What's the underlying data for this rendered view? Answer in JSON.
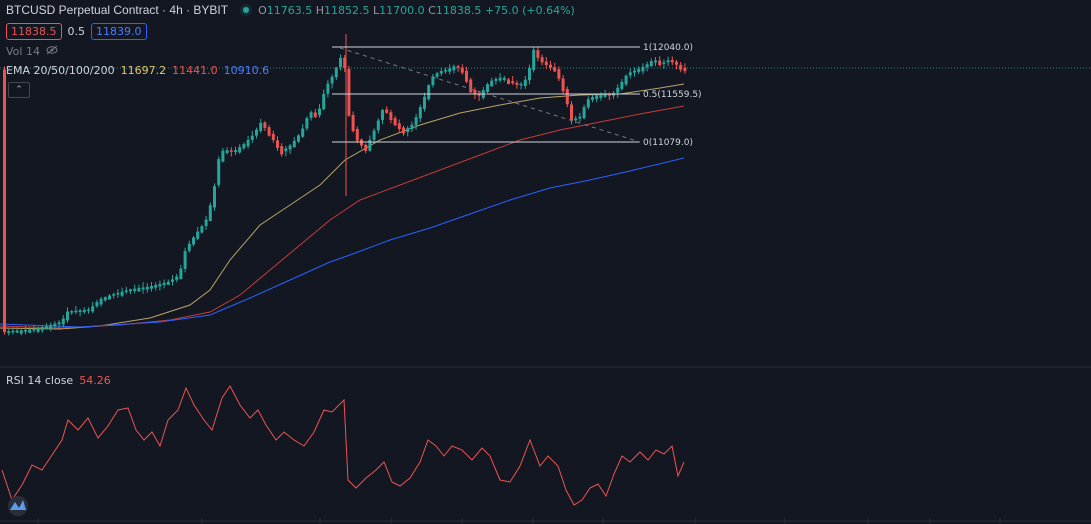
{
  "header": {
    "symbol_title": "BTCUSD Perpetual Contract · 4h · BYBIT",
    "open_label": "O",
    "open": "11763.5",
    "high_label": "H",
    "high": "11852.5",
    "low_label": "L",
    "low": "11700.0",
    "close_label": "C",
    "close": "11838.5",
    "change": "+75.0 (+0.64%)",
    "sell_price": "11838.5",
    "spread": "0.5",
    "buy_price": "11839.0"
  },
  "volume": {
    "label": "Vol 14"
  },
  "ema": {
    "label": "EMA 20/50/100/200",
    "values": [
      "11697.2",
      "11441.0",
      "10910.6"
    ],
    "colors": [
      "#e2c96a",
      "#ef5350",
      "#4f7cff"
    ]
  },
  "fib": {
    "levels": [
      {
        "label": "1(12040.0)"
      },
      {
        "label": "0.5(11559.5)"
      },
      {
        "label": "0(11079.0)"
      }
    ]
  },
  "rsi": {
    "label": "RSI 14 close",
    "value": "54.26",
    "color": "#ef5350"
  },
  "colors": {
    "background": "#131722",
    "up": "#26a69a",
    "down": "#ef5350",
    "current_price_line": "#26a69a",
    "ema20": "#b9a466",
    "ema50": "#c43c36",
    "ema100": "#2962ff"
  }
}
